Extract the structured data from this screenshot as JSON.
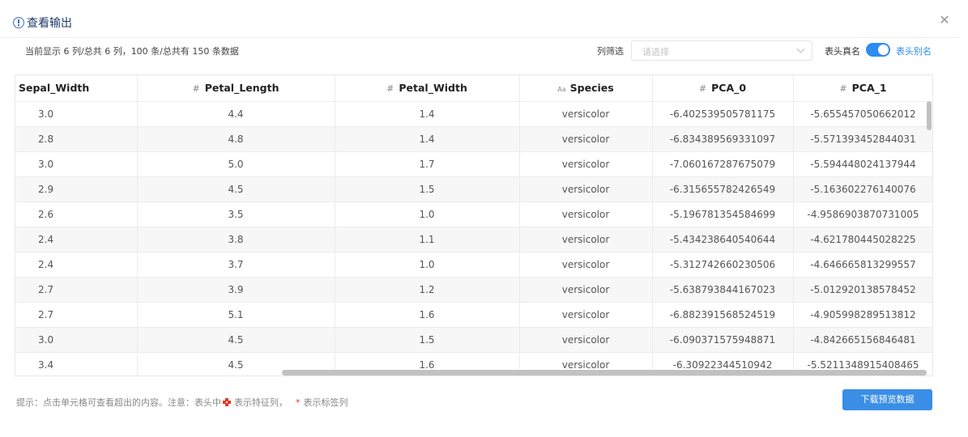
{
  "dialog": {
    "title": "查看输出",
    "summary": "当前显示 6 列/总共 6 列，100 条/总共有 150 条数据",
    "filter_label": "列筛选",
    "filter_placeholder": "请选择",
    "header_real_name_label": "表头真名",
    "header_alias_label": "表头别名",
    "toggle_on": true
  },
  "table": {
    "columns": [
      {
        "label": "Sepal_Width",
        "mark": ""
      },
      {
        "label": "Petal_Length",
        "mark": "#"
      },
      {
        "label": "Petal_Width",
        "mark": "#"
      },
      {
        "label": "Species",
        "mark": "Aa"
      },
      {
        "label": "PCA_0",
        "mark": "#"
      },
      {
        "label": "PCA_1",
        "mark": "#"
      }
    ],
    "rows": [
      [
        "3.0",
        "4.4",
        "1.4",
        "versicolor",
        "-6.402539505781175",
        "-5.655457050662012"
      ],
      [
        "2.8",
        "4.8",
        "1.4",
        "versicolor",
        "-6.834389569331097",
        "-5.571393452844031"
      ],
      [
        "3.0",
        "5.0",
        "1.7",
        "versicolor",
        "-7.060167287675079",
        "-5.594448024137944"
      ],
      [
        "2.9",
        "4.5",
        "1.5",
        "versicolor",
        "-6.315655782426549",
        "-5.163602276140076"
      ],
      [
        "2.6",
        "3.5",
        "1.0",
        "versicolor",
        "-5.196781354584699",
        "-4.9586903870731005"
      ],
      [
        "2.4",
        "3.8",
        "1.1",
        "versicolor",
        "-5.434238640540644",
        "-4.621780445028225"
      ],
      [
        "2.4",
        "3.7",
        "1.0",
        "versicolor",
        "-5.312742660230506",
        "-4.646665813299557"
      ],
      [
        "2.7",
        "3.9",
        "1.2",
        "versicolor",
        "-5.638793844167023",
        "-5.012920138578452"
      ],
      [
        "2.7",
        "5.1",
        "1.6",
        "versicolor",
        "-6.882391568524519",
        "-4.905998289513812"
      ],
      [
        "3.0",
        "4.5",
        "1.5",
        "versicolor",
        "-6.090371575948871",
        "-4.842665156846481"
      ],
      [
        "3.4",
        "4.5",
        "1.6",
        "versicolor",
        "-6.30922344510942",
        "-5.5211348915408465"
      ]
    ]
  },
  "footer": {
    "hint_prefix": "提示：点击单元格可查看超出的内容。注意：表头中",
    "hint_feature": "表示特征列，",
    "hint_star": "*",
    "hint_label": "表示标签列",
    "download_label": "下载预览数据"
  },
  "colors": {
    "accent": "#2d8cf0",
    "button": "#3a8ee6",
    "label_marker": "#e5382a"
  }
}
